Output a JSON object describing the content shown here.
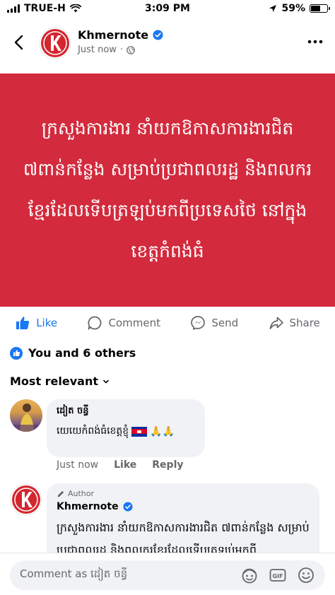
{
  "status_bar": {
    "carrier": "TRUE-H",
    "time": "3:09 PM",
    "battery": "59%"
  },
  "header": {
    "page_name": "Khmernote",
    "timestamp": "Just now"
  },
  "post": {
    "image_text": "ក្រសួងការងារ នាំយកឱកាសការងារជិត ៧ពាន់កន្លែង សម្រាប់ប្រជាពលរដ្ឋ និងពលករខ្មែរដែលទើបត្រឡប់មកពីប្រទេសថៃ នៅក្នុងខេត្តកំពង់ធំ",
    "background_color": "#d32a3d"
  },
  "actions": {
    "like": "Like",
    "comment": "Comment",
    "send": "Send",
    "share": "Share"
  },
  "reactions": {
    "summary": "You and 6 others"
  },
  "sort": {
    "label": "Most relevant"
  },
  "comments": [
    {
      "author": "ដៀត ចន្ធី",
      "text": "យេយេកំពង់ធំខេត្តខ្ញុំ",
      "emoji": "🙏🙏",
      "time": "Just now",
      "like": "Like",
      "reply": "Reply"
    },
    {
      "badge": "Author",
      "author": "Khmernote",
      "text": "ក្រសួងការងារ នាំយកឱកាសការងារជិត ៧ពាន់កន្លែង សម្រាប់ប្រជាពលរដ្ឋ និងពលករខ្មែរដែលទើបត្រឡប់មកពី"
    }
  ],
  "composer": {
    "placeholder": "Comment as ដៀត ចន្ធី"
  }
}
